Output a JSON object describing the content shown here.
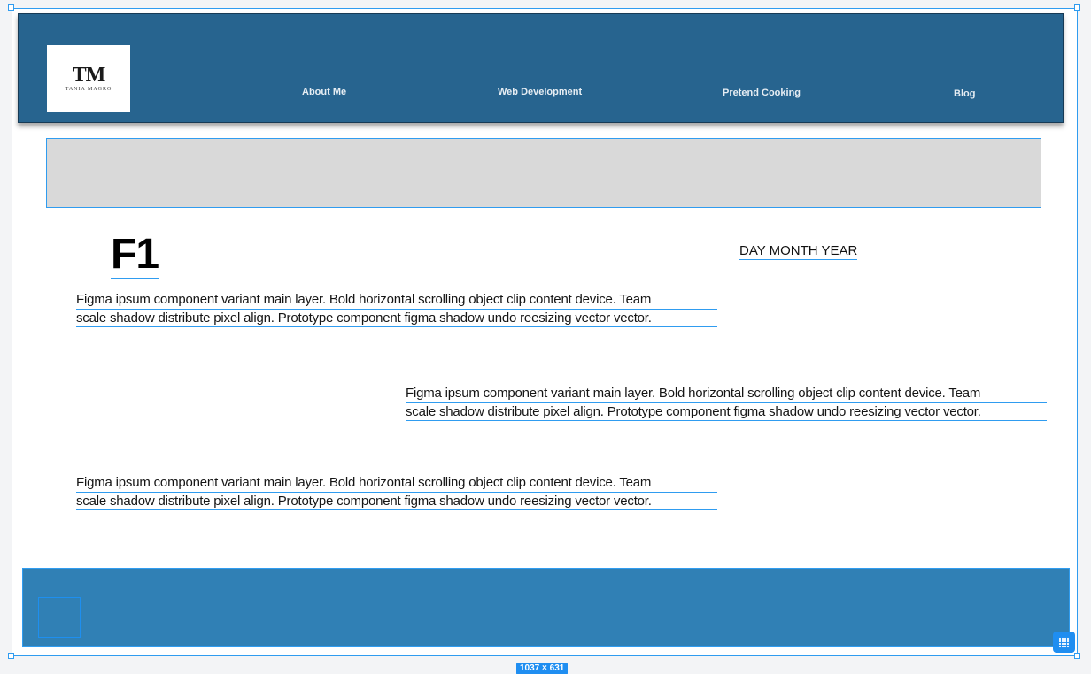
{
  "logo": {
    "mark": "TM",
    "name": "TANIA MAGRO"
  },
  "nav": {
    "items": [
      {
        "label": "About Me"
      },
      {
        "label": "Web Development"
      },
      {
        "label": "Pretend Cooking"
      },
      {
        "label": "Blog"
      }
    ]
  },
  "content": {
    "title": "F1",
    "date": "DAY MONTH YEAR",
    "paragraphs": [
      {
        "line1": "Figma ipsum component variant main layer. Bold horizontal scrolling object clip content device. Team",
        "line2": "scale shadow distribute pixel align. Prototype component figma shadow undo reesizing vector vector."
      },
      {
        "line1": "Figma ipsum component variant main layer. Bold horizontal scrolling object clip content device. Team",
        "line2": "scale shadow distribute pixel align. Prototype component figma shadow undo reesizing vector vector."
      },
      {
        "line1": "Figma ipsum component variant main layer. Bold horizontal scrolling object clip content device. Team",
        "line2": "scale shadow distribute pixel align. Prototype component figma shadow undo reesizing vector vector."
      }
    ]
  },
  "selection": {
    "size_label": "1037 × 631"
  },
  "colors": {
    "header": "#27648f",
    "footer": "#3080b5",
    "selection": "#2f9cf0",
    "hero_placeholder": "#d9d9d9"
  },
  "icons": {
    "grid": "grid-icon"
  }
}
